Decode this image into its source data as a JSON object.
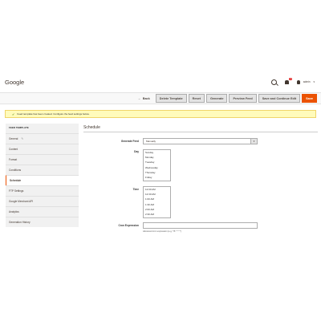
{
  "page": {
    "title": "Google"
  },
  "header": {
    "notification_count": "1",
    "user_name": "admin",
    "user_chevron": "▾"
  },
  "toolbar": {
    "back_arrow": "←",
    "back": "Back",
    "delete_template": "Delete Template",
    "reset": "Reset",
    "generate": "Generate",
    "preview_feed": "Preview Feed",
    "save_continue": "Save and Continue Edit",
    "save": "Save"
  },
  "message": {
    "icon": "✔",
    "text": "Feed template has been created. Configure the feed settings below."
  },
  "sidebar": {
    "title": "FEED TEMPLATE",
    "pencil": "✎",
    "items": [
      {
        "label": "General"
      },
      {
        "label": "Content"
      },
      {
        "label": "Format"
      },
      {
        "label": "Conditions"
      },
      {
        "label": "Schedule"
      },
      {
        "label": "FTP Settings"
      },
      {
        "label": "Google Merchant API"
      },
      {
        "label": "Analytics"
      },
      {
        "label": "Generation History"
      }
    ]
  },
  "section": {
    "title": "Schedule"
  },
  "form": {
    "generate_feed_label": "Generate Feed",
    "generate_feed_value": "Manually",
    "select_arrow": "▾",
    "day_label": "Day",
    "days": [
      "Sunday",
      "Monday",
      "Tuesday",
      "Wednesday",
      "Thursday",
      "Friday"
    ],
    "time_label": "Time",
    "times": [
      "12:00 AM",
      "12:30 AM",
      "1:00 AM",
      "1:30 AM",
      "2:00 AM",
      "2:30 AM"
    ],
    "cron_label": "Cron Expression",
    "cron_note": "Advanced cron expression (e.g. */5 * * * *)"
  },
  "colors": {
    "accent": "#eb5202",
    "message_bg": "#fffbbb",
    "sidebar_bg": "#f1f1f1"
  }
}
